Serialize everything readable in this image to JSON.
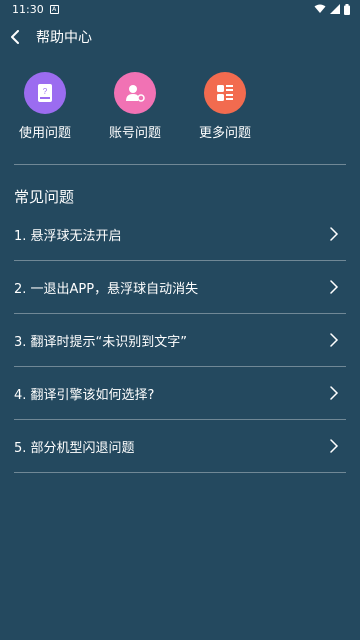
{
  "status": {
    "time": "11:30",
    "a_badge": "A"
  },
  "appbar": {
    "title": "帮助中心"
  },
  "quick": [
    {
      "label": "使用问题",
      "color": "#9b6cf0"
    },
    {
      "label": "账号问题",
      "color": "#f172b4"
    },
    {
      "label": "更多问题",
      "color": "#f26b4f"
    }
  ],
  "faq": {
    "title": "常见问题",
    "items": [
      "1. 悬浮球无法开启",
      "2. 一退出APP，悬浮球自动消失",
      "3. 翻译时提示“未识别到文字”",
      "4. 翻译引擎该如何选择?",
      "5. 部分机型闪退问题"
    ]
  }
}
